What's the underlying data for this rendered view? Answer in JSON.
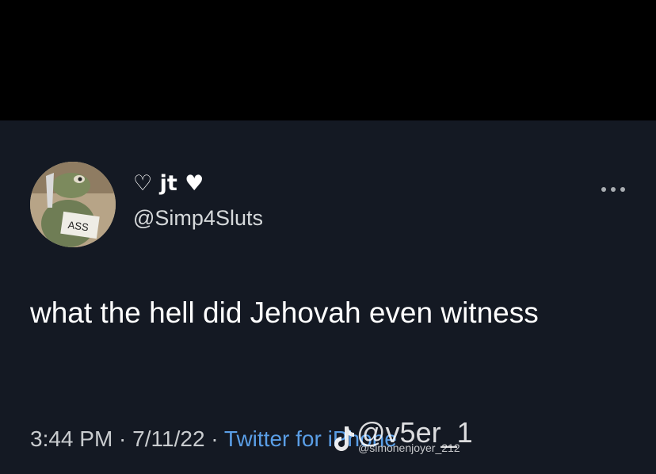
{
  "tweet": {
    "display_name": "♡ jt ♥",
    "handle": "@Simp4Sluts",
    "avatar_label": "ASS",
    "text": "what the hell did Jehovah even witness",
    "time": "3:44 PM",
    "separator": " · ",
    "date": "7/11/22",
    "source": "Twitter for iPhone"
  },
  "watermark": {
    "handle": "@v5er_1",
    "sub_handle": "@simonenjoyer_212"
  },
  "icons": {
    "more": "more-horizontal-icon",
    "watermark_logo": "tiktok-logo-icon"
  },
  "colors": {
    "background": "#141923",
    "top_bar": "#000000",
    "link": "#5a9ee6"
  }
}
